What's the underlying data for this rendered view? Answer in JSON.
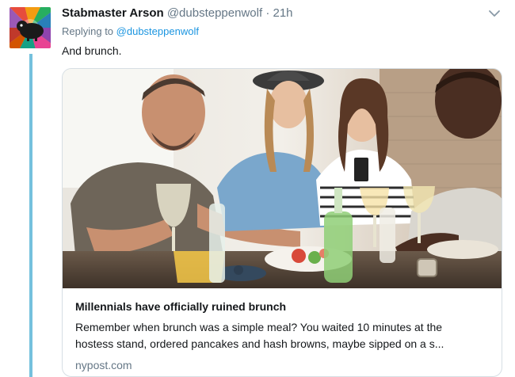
{
  "tweet": {
    "author_name": "Stabmaster Arson",
    "handle": "@dubsteppenwolf",
    "separator": "·",
    "time": "21h",
    "replying_prefix": "Replying to",
    "replying_to": "@dubsteppenwolf",
    "text": "And brunch."
  },
  "card": {
    "title": "Millennials have officially ruined brunch",
    "description_line1": "Remember when brunch was a simple meal? You waited 10 minutes at the",
    "description_line2": "hostess stand, ordered pancakes and hash browns, maybe sipped on a s...",
    "domain": "nypost.com"
  },
  "icons": {
    "menu": "chevron-down-icon"
  },
  "colors": {
    "link": "#1b95e0",
    "thread_line": "#75c1dd",
    "muted": "#657786"
  }
}
